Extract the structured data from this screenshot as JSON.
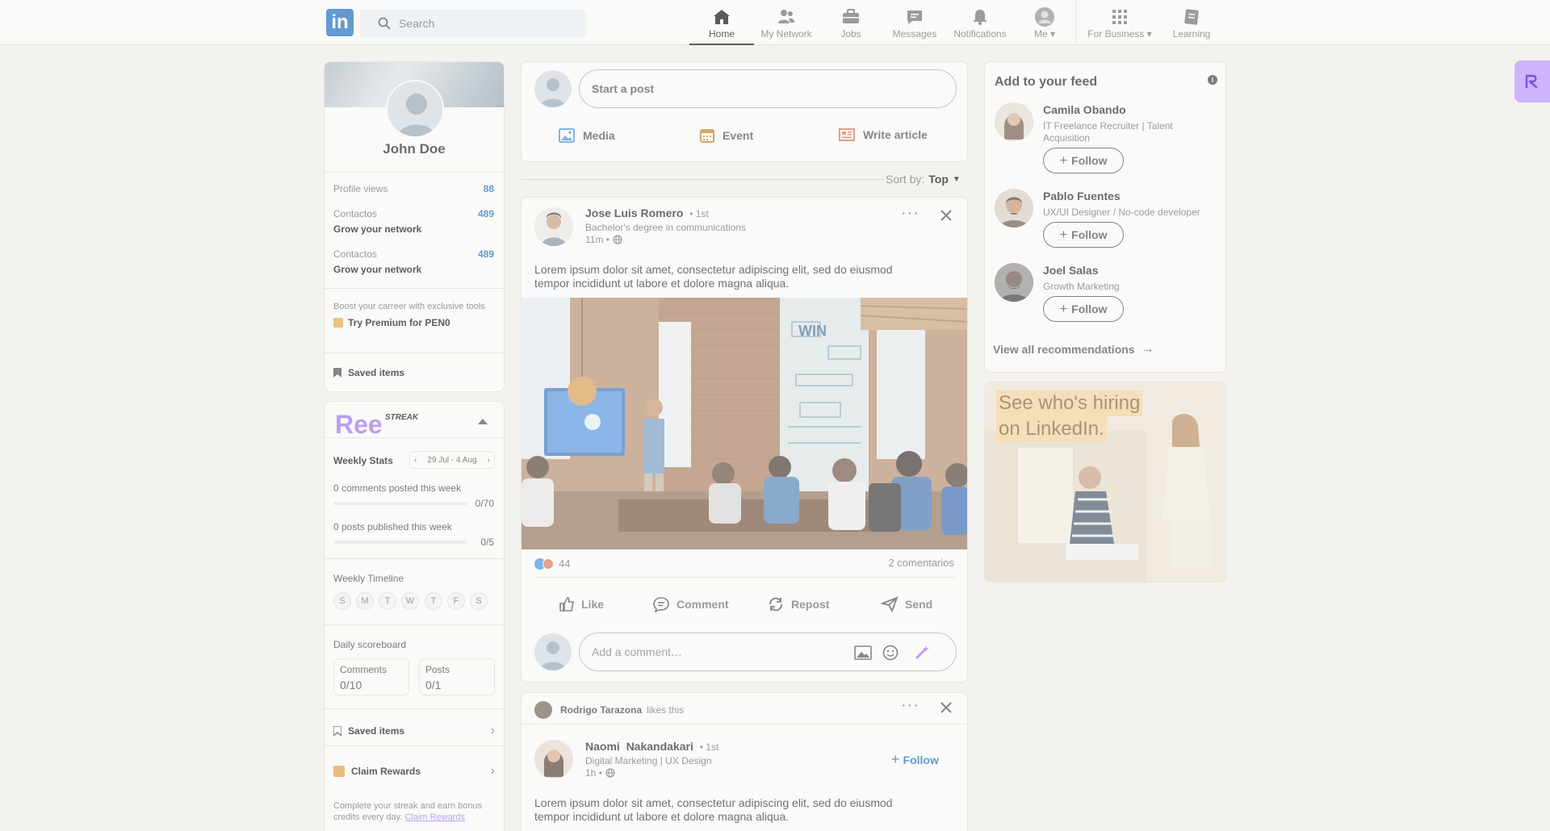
{
  "header": {
    "logo_text": "in",
    "search_placeholder": "Search",
    "nav": [
      {
        "label": "Home",
        "icon": "home-icon"
      },
      {
        "label": "My Network",
        "icon": "network-icon"
      },
      {
        "label": "Jobs",
        "icon": "briefcase-icon"
      },
      {
        "label": "Messages",
        "icon": "message-icon"
      },
      {
        "label": "Notifications",
        "icon": "bell-icon"
      },
      {
        "label": "Me",
        "icon": "avatar"
      },
      {
        "label": "For Business",
        "icon": "grid-icon"
      },
      {
        "label": "Learning",
        "icon": "learning-icon"
      }
    ]
  },
  "profile": {
    "name": "John Doe",
    "profile_views_label": "Profile views",
    "profile_views": "88",
    "contacts_label": "Contactos",
    "contacts_count": "489",
    "grow_label": "Grow your network",
    "contacts_label_2": "Contactos",
    "contacts_count_2": "489",
    "grow_label_2": "Grow your network",
    "premium_text": "Boost your carreer with exclusive tools",
    "premium_cta": "Try Premium for PEN0",
    "saved_items": "Saved items"
  },
  "streak": {
    "logo": "Ree",
    "logo_sup": "STREAK",
    "weekly_stats": "Weekly Stats",
    "date_range": "29 Jul - 4 Aug",
    "comments_text": "0 comments posted this week",
    "comments_progress": "0/70",
    "posts_text": "0 posts published this week",
    "posts_progress": "0/5",
    "timeline_title": "Weekly Timeline",
    "days": [
      "S",
      "M",
      "T",
      "W",
      "T",
      "F",
      "S"
    ],
    "scoreboard_title": "Daily scoreboard",
    "sb_comments_label": "Comments",
    "sb_comments_value": "0/10",
    "sb_posts_label": "Posts",
    "sb_posts_value": "0/1",
    "saved_items": "Saved items",
    "claim_rewards": "Claim Rewards",
    "footer_text": "Complete your streak and earn bonus credits every day.",
    "footer_link": "Claim Rewards"
  },
  "composer": {
    "placeholder": "Start a post",
    "media": "Media",
    "event": "Event",
    "article": "Write article"
  },
  "sort": {
    "label": "Sort by:",
    "value": "Top"
  },
  "post1": {
    "author": "Jose Luis Romero",
    "degree": "• 1st",
    "headline": "Bachelor's degree in communications",
    "time": "11m •",
    "text_line1": "Lorem ipsum dolor sit amet, consectetur adipiscing elit, sed do eiusmod",
    "text_line2": "tempor incididunt ut labore et dolore magna aliqua.",
    "image_sign": "WIN",
    "reactions": "44",
    "comments": "2 comentarios",
    "actions": {
      "like": "Like",
      "comment": "Comment",
      "repost": "Repost",
      "send": "Send"
    },
    "comment_placeholder": "Add a comment…"
  },
  "post2": {
    "liker": "Rodrigo Tarazona",
    "likes_this": "likes this",
    "author": "Naomi  Nakandakari",
    "degree": "• 1st",
    "headline": "Digital Marketing | UX Design",
    "time": "1h •",
    "follow": "Follow",
    "text_line1": "Lorem ipsum dolor sit amet, consectetur adipiscing elit, sed do eiusmod",
    "text_line2": "tempor incididunt ut labore et dolore magna aliqua."
  },
  "feed": {
    "title": "Add to your feed",
    "people": [
      {
        "name": "Camila Obando",
        "headline_1": "IT Freelance Recruiter | Talent",
        "headline_2": "Acquisition",
        "follow": "Follow"
      },
      {
        "name": "Pablo Fuentes",
        "headline_1": "UX/UI Designer / No-code developer",
        "headline_2": "",
        "follow": "Follow"
      },
      {
        "name": "Joel Salas",
        "headline_1": "Growth Marketing",
        "headline_2": "",
        "follow": "Follow"
      }
    ],
    "view_all": "View all recommendations"
  },
  "ad": {
    "line1": "See who's hiring",
    "line2": "on LinkedIn."
  },
  "colors": {
    "brand": "#0a66c2",
    "streak_purple": "#9b6cf5",
    "bg": "#f4f2ee"
  }
}
